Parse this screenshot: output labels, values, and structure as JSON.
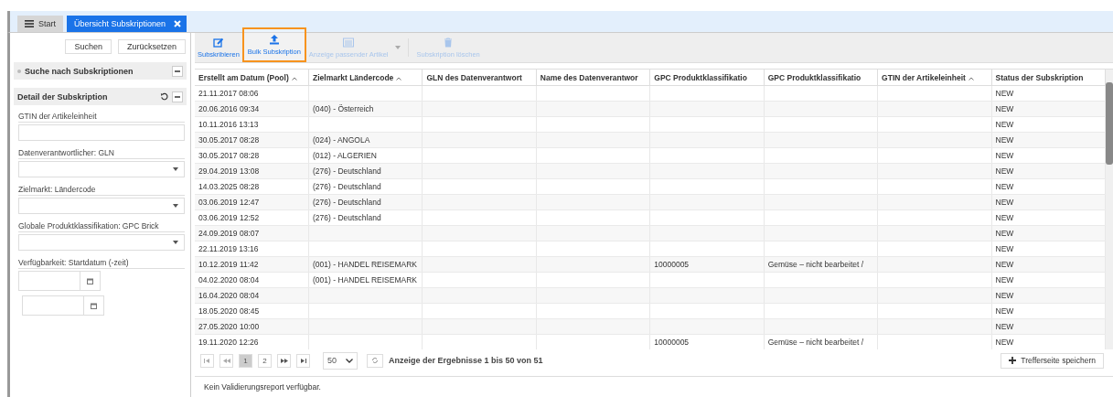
{
  "tabs": [
    {
      "label": "Start",
      "kind": "menu",
      "selected": false
    },
    {
      "label": "Übersicht Subskriptionen",
      "kind": "closable",
      "selected": true
    }
  ],
  "sidebar": {
    "buttons": [
      "Suchen",
      "Zurücksetzen"
    ],
    "search_section": {
      "title": "Suche nach Subskriptionen",
      "expanded": false
    },
    "detail_section": {
      "title": "Detail der Subskription",
      "expanded": true,
      "fields": [
        {
          "label": "GTIN der Artikeleinheit",
          "kind": "text"
        },
        {
          "label": "Datenverantwortlicher: GLN",
          "kind": "select"
        },
        {
          "label": "Zielmarkt: Ländercode",
          "kind": "select"
        },
        {
          "label": "Globale Produktklassifikation: GPC Brick",
          "kind": "select"
        },
        {
          "label": "Verfügbarkeit: Startdatum (-zeit)",
          "kind": "date"
        }
      ]
    }
  },
  "toolbar": [
    {
      "label": "Subskribieren",
      "disabled": false,
      "highlighted": false,
      "dropdown": false
    },
    {
      "label": "Bulk Subskription",
      "disabled": false,
      "highlighted": true,
      "dropdown": false
    },
    {
      "label": "Anzeige passender Artikel",
      "disabled": true,
      "highlighted": false,
      "dropdown": true
    },
    {
      "label": "Subskription löschen",
      "disabled": true,
      "highlighted": false,
      "dropdown": false
    }
  ],
  "table": {
    "columns": [
      {
        "label": "Erstellt am Datum (Pool)",
        "sortable": true
      },
      {
        "label": "Zielmarkt Ländercode",
        "sortable": true
      },
      {
        "label": "GLN des Datenverantwort",
        "sortable": false
      },
      {
        "label": "Name des Datenverantwor",
        "sortable": false
      },
      {
        "label": "GPC Produktklassifikatio",
        "sortable": false
      },
      {
        "label": "GPC Produktklassifikatio",
        "sortable": false
      },
      {
        "label": "GTIN der Artikeleinheit",
        "sortable": true
      },
      {
        "label": "Status der Subskription",
        "sortable": false
      }
    ],
    "rows": [
      {
        "created": "21.11.2017 08:06",
        "status": "NEW"
      },
      {
        "created": "20.06.2016 09:34",
        "country": "(040) - Österreich",
        "status": "NEW"
      },
      {
        "created": "10.11.2016 13:13",
        "status": "NEW"
      },
      {
        "created": "30.05.2017 08:28",
        "country": "(024) - ANGOLA",
        "status": "NEW"
      },
      {
        "created": "30.05.2017 08:28",
        "country": "(012) - ALGERIEN",
        "status": "NEW"
      },
      {
        "created": "29.04.2019 13:08",
        "country": "(276) - Deutschland",
        "status": "NEW"
      },
      {
        "created": "14.03.2025 08:28",
        "country": "(276) - Deutschland",
        "status": "NEW"
      },
      {
        "created": "03.06.2019 12:47",
        "country": "(276) - Deutschland",
        "status": "NEW"
      },
      {
        "created": "03.06.2019 12:52",
        "country": "(276) - Deutschland",
        "status": "NEW"
      },
      {
        "created": "24.09.2019 08:07",
        "status": "NEW"
      },
      {
        "created": "22.11.2019 13:16",
        "status": "NEW"
      },
      {
        "created": "10.12.2019 11:42",
        "country": "(001) - HANDEL REISEMARK",
        "gpc_code": "10000005",
        "gpc_name": "Gemüse – nicht bearbeitet /",
        "status": "NEW"
      },
      {
        "created": "04.02.2020 08:04",
        "country": "(001) - HANDEL REISEMARK",
        "status": "NEW"
      },
      {
        "created": "16.04.2020 08:04",
        "status": "NEW"
      },
      {
        "created": "18.05.2020 08:45",
        "status": "NEW"
      },
      {
        "created": "27.05.2020 10:00",
        "status": "NEW"
      },
      {
        "created": "19.11.2020 12:26",
        "gpc_code": "10000005",
        "gpc_name": "Gemüse – nicht bearbeitet /",
        "status": "NEW"
      }
    ]
  },
  "pager": {
    "pages": [
      {
        "label": "1",
        "selected": true
      },
      {
        "label": "2",
        "selected": false
      }
    ],
    "page_size": "50",
    "summary": "Anzeige der Ergebnisse 1 bis 50 von 51"
  },
  "save_button": "Trefferseite speichern",
  "status_bar": "Kein Validierungsreport verfügbar."
}
